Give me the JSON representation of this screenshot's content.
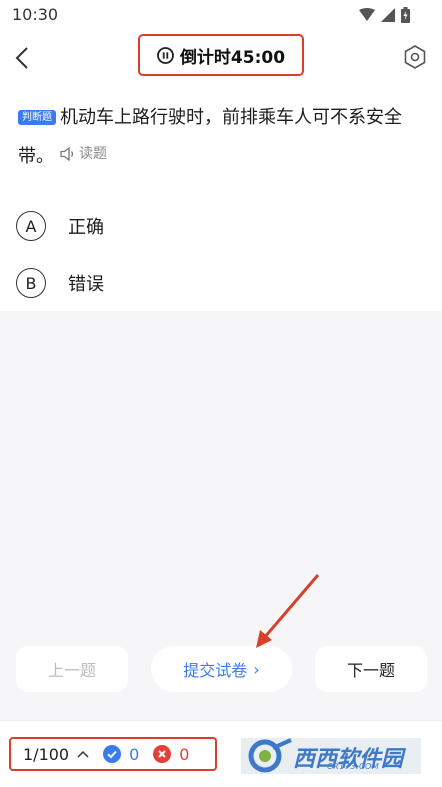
{
  "status_bar": {
    "time": "10:30"
  },
  "header": {
    "timer_text": "倒计时45:00"
  },
  "question": {
    "type_badge": "判断题",
    "text": "机动车上路行驶时，前排乘车人可不系安全带。",
    "read_label": "读题"
  },
  "options": [
    {
      "letter": "A",
      "text": "正确"
    },
    {
      "letter": "B",
      "text": "错误"
    }
  ],
  "nav": {
    "prev_label": "上一题",
    "submit_label": "提交试卷",
    "submit_chevron": "›",
    "next_label": "下一题"
  },
  "footer": {
    "progress": "1/100",
    "correct_count": "0",
    "wrong_count": "0"
  },
  "watermark": {
    "text": "西西软件园",
    "sub": "CR173.COM"
  },
  "colors": {
    "accent": "#3a7bef",
    "annotation_red": "#d9402b",
    "wrong_red": "#e2413a"
  }
}
